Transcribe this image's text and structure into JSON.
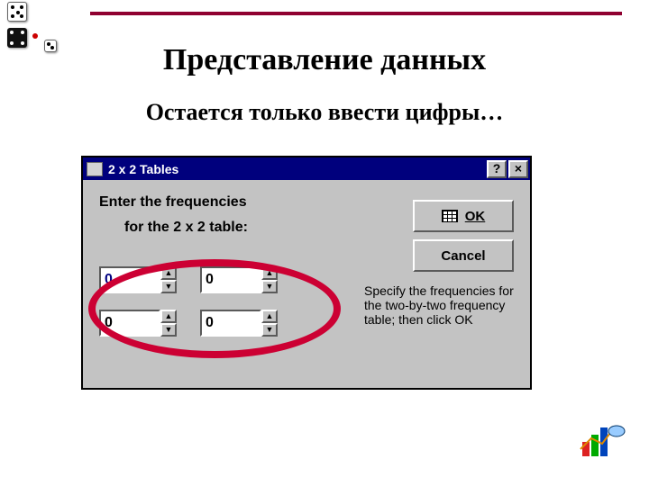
{
  "page": {
    "title": "Представление данных",
    "subtitle": "Остается только ввести цифры…"
  },
  "dialog": {
    "title": "2 x 2 Tables",
    "instruction_line1": "Enter the frequencies",
    "instruction_line2": "for the 2 x 2 table:",
    "help_glyph": "?",
    "close_glyph": "×",
    "ok_label": "OK",
    "cancel_label": "Cancel",
    "hint": "Specify the frequencies for the two-by-two frequency table; then click OK",
    "cells": {
      "r1c1": "0",
      "r1c2": "0",
      "r2c1": "0",
      "r2c2": "0"
    }
  },
  "icons": {
    "up": "▲",
    "down": "▼"
  }
}
